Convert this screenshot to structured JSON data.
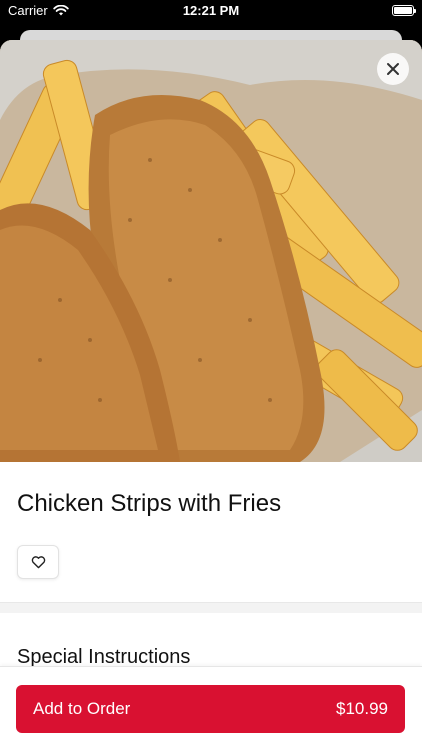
{
  "status_bar": {
    "carrier": "Carrier",
    "time": "12:21 PM"
  },
  "item": {
    "name": "Chicken Strips with Fries"
  },
  "sections": {
    "special_instructions": "Special Instructions"
  },
  "actions": {
    "add_to_order_label": "Add to Order",
    "price": "$10.99"
  },
  "icons": {
    "close": "close-icon",
    "favorite": "heart-icon",
    "wifi": "wifi-icon",
    "battery": "battery-icon"
  },
  "colors": {
    "primary": "#d91131",
    "divider": "#f3f3f3"
  }
}
